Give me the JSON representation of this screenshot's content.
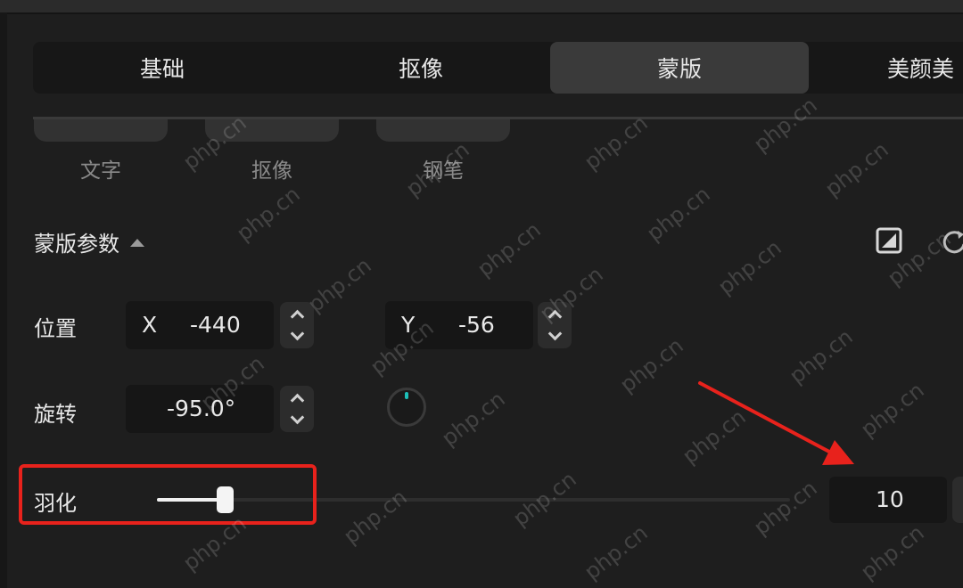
{
  "tabs": [
    {
      "label": "基础",
      "active": false
    },
    {
      "label": "抠像",
      "active": false
    },
    {
      "label": "蒙版",
      "active": true
    },
    {
      "label": "美颜美",
      "active": false
    }
  ],
  "shapes": [
    {
      "label": "文字"
    },
    {
      "label": "抠像"
    },
    {
      "label": "钢笔"
    }
  ],
  "params": {
    "title": "蒙版参数",
    "position_label": "位置",
    "x_axis": "X",
    "x_value": "-440",
    "y_axis": "Y",
    "y_value": "-56",
    "rotation_label": "旋转",
    "rotation_value": "-95.0°",
    "feather_label": "羽化",
    "feather_value": "10",
    "feather_fraction": 0.1
  },
  "watermark": "php.cn",
  "colors": {
    "highlight": "#e8221c",
    "dial_accent": "#1dbfb8"
  }
}
